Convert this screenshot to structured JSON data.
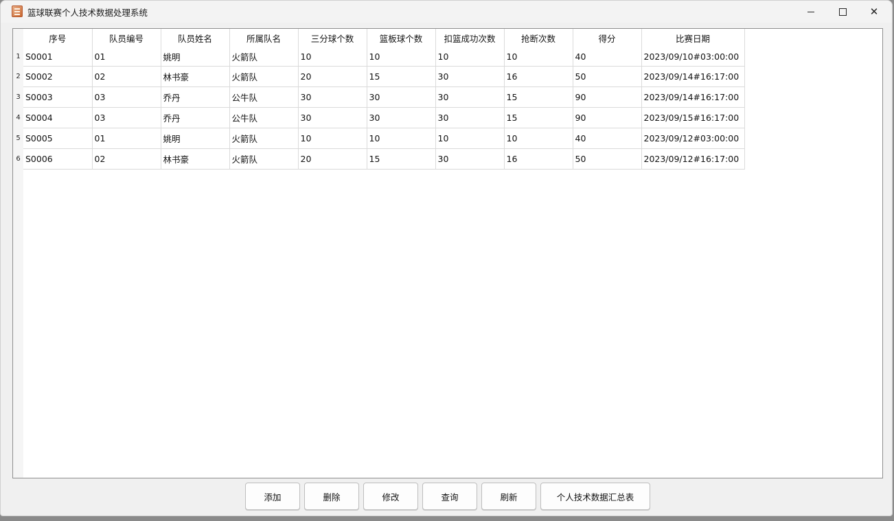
{
  "window": {
    "title": "篮球联赛个人技术数据处理系统"
  },
  "table": {
    "columns": [
      "序号",
      "队员编号",
      "队员姓名",
      "所属队名",
      "三分球个数",
      "篮板球个数",
      "扣篮成功次数",
      "抢断次数",
      "得分",
      "比赛日期"
    ],
    "rows": [
      {
        "n": "1",
        "cells": [
          "S0001",
          "01",
          "姚明",
          "火箭队",
          "10",
          "10",
          "10",
          "10",
          "40",
          "2023/09/10#03:00:00"
        ]
      },
      {
        "n": "2",
        "cells": [
          "S0002",
          "02",
          "林书豪",
          "火箭队",
          "20",
          "15",
          "30",
          "16",
          "50",
          "2023/09/14#16:17:00"
        ]
      },
      {
        "n": "3",
        "cells": [
          "S0003",
          "03",
          "乔丹",
          "公牛队",
          "30",
          "30",
          "30",
          "15",
          "90",
          "2023/09/14#16:17:00"
        ]
      },
      {
        "n": "4",
        "cells": [
          "S0004",
          "03",
          "乔丹",
          "公牛队",
          "30",
          "30",
          "30",
          "15",
          "90",
          "2023/09/15#16:17:00"
        ]
      },
      {
        "n": "5",
        "cells": [
          "S0005",
          "01",
          "姚明",
          "火箭队",
          "10",
          "10",
          "10",
          "10",
          "40",
          "2023/09/12#03:00:00"
        ]
      },
      {
        "n": "6",
        "cells": [
          "S0006",
          "02",
          "林书豪",
          "火箭队",
          "20",
          "15",
          "30",
          "16",
          "50",
          "2023/09/12#16:17:00"
        ]
      }
    ]
  },
  "toolbar": {
    "add_label": "添加",
    "delete_label": "删除",
    "edit_label": "修改",
    "query_label": "查询",
    "refresh_label": "刷新",
    "summary_label": "个人技术数据汇总表"
  }
}
